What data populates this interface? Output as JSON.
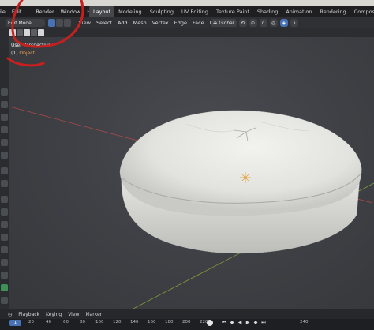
{
  "menubar": {
    "items": [
      "File",
      "Edit",
      "Render",
      "Window",
      "Help"
    ],
    "workspaces": [
      "Layout",
      "Modeling",
      "Sculpting",
      "UV Editing",
      "Texture Paint",
      "Shading",
      "Animation",
      "Rendering",
      "Compositing"
    ],
    "active_workspace": "Layout"
  },
  "header": {
    "mode": "Edit Mode",
    "menus": [
      "View",
      "Select",
      "Add",
      "Mesh",
      "Vertex",
      "Edge",
      "Face",
      "UV"
    ],
    "orientation": "Global"
  },
  "viewport": {
    "title": "User Perspective",
    "subtitle_prefix": "(1) ",
    "subtitle_object": "Object"
  },
  "timeline": {
    "menus": [
      "Playback",
      "Keying",
      "View",
      "Marker"
    ],
    "current_frame": "1",
    "ticks": [
      "20",
      "40",
      "60",
      "80",
      "100",
      "120",
      "140",
      "160",
      "180",
      "200",
      "220",
      "240"
    ]
  },
  "colors": {
    "accent": "#4772b3",
    "annotation": "#c8201e",
    "x_axis": "#c74a4a",
    "y_axis": "#8bb33c",
    "object": "#e8e8e4"
  }
}
